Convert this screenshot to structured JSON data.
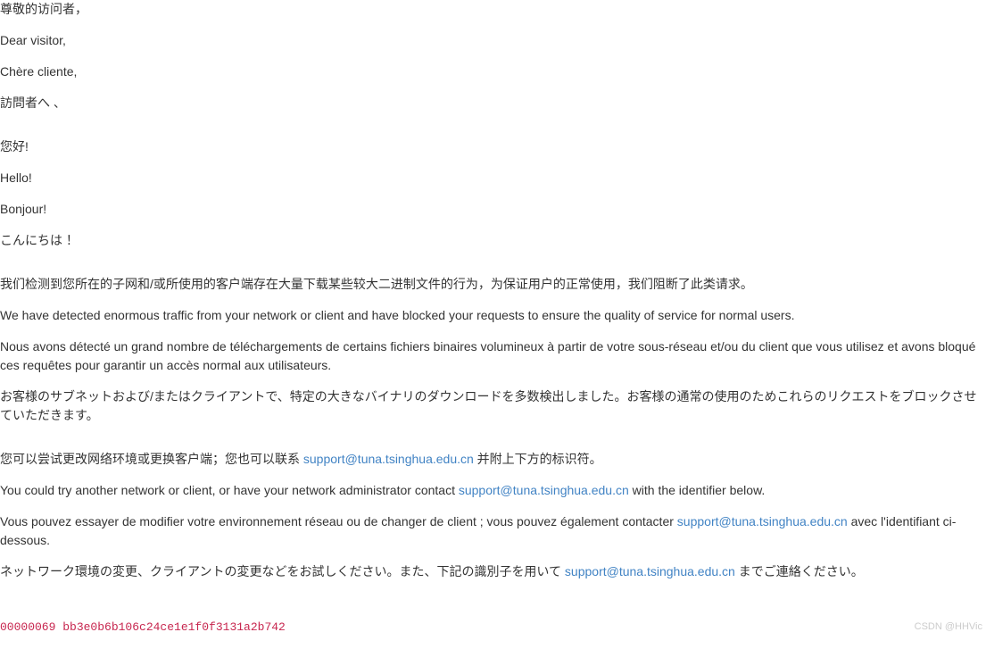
{
  "greetings": {
    "zh_title": "尊敬的访问者，",
    "en_title": "Dear visitor,",
    "fr_title": "Chère cliente,",
    "ja_title": "訪問者へ 、",
    "zh_hello": "您好!",
    "en_hello": "Hello!",
    "fr_hello": "Bonjour!",
    "ja_hello": "こんにちは ！"
  },
  "detection": {
    "zh": "我们检测到您所在的子网和/或所使用的客户端存在大量下载某些较大二进制文件的行为，为保证用户的正常使用，我们阻断了此类请求。",
    "en": "We have detected enormous traffic from your network or client and have blocked your requests to ensure the quality of service for normal users.",
    "fr": "Nous avons détecté un grand nombre de téléchargements de certains fichiers binaires volumineux à partir de votre sous-réseau et/ou du client que vous utilisez et avons bloqué ces requêtes pour garantir un accès normal aux utilisateurs.",
    "ja": "お客様のサブネットおよび/またはクライアントで、特定の大きなバイナリのダウンロードを多数検出しました。お客様の通常の使用のためこれらのリクエストをブロックさせていただきます。"
  },
  "suggestion": {
    "zh_pre": "您可以尝试更改网络环境或更换客户端；您也可以联系 ",
    "zh_post": " 并附上下方的标识符。",
    "en_pre": "You could try another network or client, or have your network administrator contact ",
    "en_post": " with the identifier below.",
    "fr_pre": "Vous pouvez essayer de modifier votre environnement réseau ou de changer de client ; vous pouvez également contacter ",
    "fr_post": " avec l'identifiant ci-dessous.",
    "ja_pre": "ネットワーク環境の変更、クライアントの変更などをお試しください。また、下記の識別子を用いて ",
    "ja_post": " までご連絡ください。"
  },
  "email": "support@tuna.tsinghua.edu.cn",
  "email_href": "mailto:support@tuna.tsinghua.edu.cn",
  "identifier": "00000069 bb3e0b6b106c24ce1e1f0f3131a2b742",
  "watermark": "CSDN @HHVic"
}
